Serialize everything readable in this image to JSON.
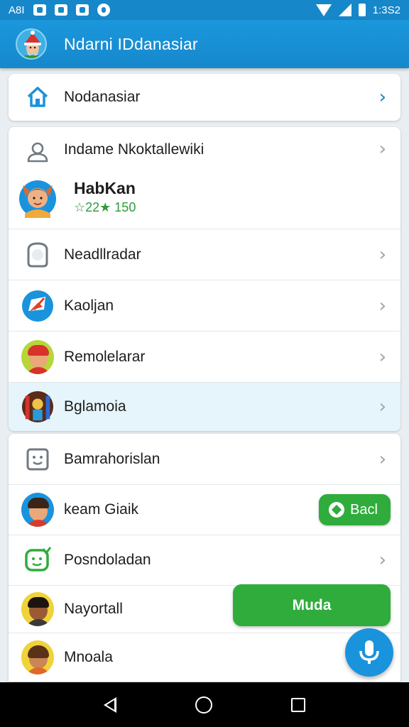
{
  "status_bar": {
    "left_text": "A8I",
    "time": "1:3S2",
    "icons": [
      "image-icon",
      "notification-icon",
      "message-icon",
      "app-icon",
      "wifi-icon",
      "signal-icon",
      "battery-icon"
    ]
  },
  "app_bar": {
    "title": "Ndarni IDdanasiar",
    "avatar_icon": "santa-avatar"
  },
  "top_card": {
    "label": "Nodanasiar",
    "icon": "home-icon",
    "accent": "#1a7fbf"
  },
  "list_one": {
    "header_label": "Indame Nkoktallewiki",
    "header_icon": "person-icon",
    "profile": {
      "name": "HabKan",
      "rating_text": "☆22★ 150",
      "avatar_icon": "fox-avatar"
    },
    "items": [
      {
        "label": "Neadllradar",
        "icon": "chat-bubble-icon"
      },
      {
        "label": "Kaoljan",
        "icon": "map-icon"
      },
      {
        "label": "Remolelarar",
        "icon": "boy-avatar"
      },
      {
        "label": "Bglamoia",
        "icon": "game-avatar"
      }
    ]
  },
  "list_two": {
    "items": [
      {
        "label": "Bamrahorislan",
        "icon": "smiley-box-icon"
      },
      {
        "label": "keam Giaik",
        "icon": "man-avatar",
        "button": "Bacl"
      },
      {
        "label": "Posndoladan",
        "icon": "green-chat-icon"
      },
      {
        "label": "Nayortall",
        "icon": "dark-man-avatar"
      },
      {
        "label": "Mnoala",
        "icon": "woman-avatar"
      }
    ]
  },
  "muda_button": {
    "label": "Muda"
  },
  "fab": {
    "icon": "microphone-icon"
  },
  "colors": {
    "primary": "#1a93dd",
    "green": "#2fac3c",
    "highlight": "#e6f4fb"
  }
}
